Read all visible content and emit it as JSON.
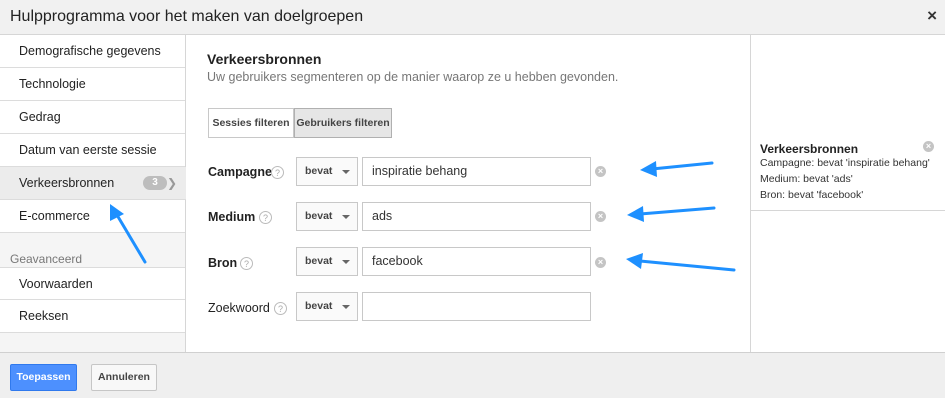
{
  "window": {
    "title": "Hulpprogramma voor het maken van doelgroepen",
    "close_symbol": "×"
  },
  "sidebar": {
    "items": [
      {
        "label": "Demografische gegevens"
      },
      {
        "label": "Technologie"
      },
      {
        "label": "Gedrag"
      },
      {
        "label": "Datum van eerste sessie"
      },
      {
        "label": "Verkeersbronnen",
        "badge": "3",
        "active": true
      },
      {
        "label": "E-commerce"
      }
    ],
    "section_label": "Geavanceerd",
    "advanced_items": [
      {
        "label": "Voorwaarden"
      },
      {
        "label": "Reeksen"
      }
    ]
  },
  "main": {
    "title": "Verkeersbronnen",
    "subtitle": "Uw gebruikers segmenteren op de manier waarop ze u hebben gevonden.",
    "segment_buttons": [
      {
        "label": "Sessies filteren",
        "active": false
      },
      {
        "label": "Gebruikers filteren",
        "active": true
      }
    ],
    "filters": [
      {
        "label": "Campagne",
        "operator": "bevat",
        "value": "inspiratie behang"
      },
      {
        "label": "Medium",
        "operator": "bevat",
        "value": "ads"
      },
      {
        "label": "Bron",
        "operator": "bevat",
        "value": "facebook"
      },
      {
        "label": "Zoekwoord",
        "operator": "bevat",
        "value": ""
      }
    ],
    "help_symbol": "?"
  },
  "summary": {
    "title": "Verkeersbronnen",
    "lines": [
      "Campagne: bevat 'inspiratie behang'",
      "Medium: bevat 'ads'",
      "Bron: bevat 'facebook'"
    ]
  },
  "footer": {
    "apply_label": "Toepassen",
    "cancel_label": "Annuleren"
  },
  "colors": {
    "accent": "#4d90fe",
    "annotation_arrow": "#1e90ff"
  }
}
